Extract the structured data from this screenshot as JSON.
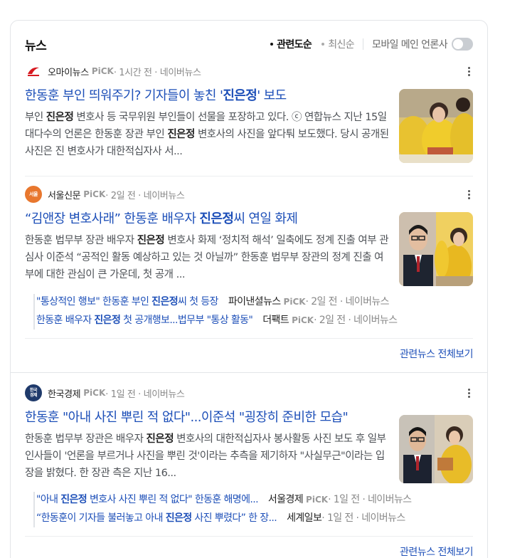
{
  "header": {
    "title": "뉴스",
    "filter_relevance": "관련도순",
    "filter_latest": "최신순",
    "mobile_main_label": "모바일 메인 언론사"
  },
  "articles": [
    {
      "publisher": "오마이뉴스",
      "pick": "PiCK",
      "meta": " · 1시간 전 · 네이버뉴스",
      "title_pre": "한동훈 부인 띄워주기? 기자들이 놓친 '",
      "title_bold": "진은정",
      "title_post": "' 보도",
      "snippet_parts": [
        "부인 ",
        "진은정",
        " 변호사 등 국무위원 부인들이 선물을 포장하고 있다. ⓒ 연합뉴스 지난 15일 대다수의 언론은 한동훈 장관 부인 ",
        "진은정",
        " 변호사의 사진을 앞다퉈 보도했다. 당시 공개된 사진은 진 변호사가 대한적십자사 서..."
      ],
      "logo_color": "#d71920"
    },
    {
      "publisher": "서울신문",
      "pick": "PiCK",
      "meta": " · 2일 전 · 네이버뉴스",
      "title_pre": "“김앤장 변호사래” 한동훈 배우자 ",
      "title_bold": "진은정",
      "title_post": "씨 연일 화제",
      "snippet_parts": [
        "한동훈 법무부 장관 배우자 ",
        "진은정",
        " 변호사 화제 ‘정치적 해석’ 일축에도 정계 진출 여부 관심사 이준석 “공적인 활동 예상하고 있는 것 아닐까” 한동훈 법무부 장관의 정계 진출 여부에 대한 관심이 큰 가운데, 첫 공개 ..."
      ],
      "logo_color": "#e8772e",
      "related": [
        {
          "pre": "\"통상적인 행보\" 한동훈 부인 ",
          "bold": "진은정",
          "post": "씨 첫 등장",
          "source": "파이낸셜뉴스",
          "pick": "PiCK",
          "meta": " · 2일 전 · 네이버뉴스"
        },
        {
          "pre": "한동훈 배우자 ",
          "bold": "진은정",
          "post": " 첫 공개행보...법무부 \"통상 활동\"",
          "source": "더팩트",
          "pick": "PiCK",
          "meta": " · 2일 전 · 네이버뉴스"
        }
      ],
      "more_label": "관련뉴스 전체보기"
    },
    {
      "publisher": "한국경제",
      "pick": "PiCK",
      "meta": " · 1일 전 · 네이버뉴스",
      "title_pre": "한동훈 \"아내 사진 뿌린 적 없다\"...이준석 \"굉장히 준비한 모습\"",
      "title_bold": "",
      "title_post": "",
      "snippet_parts": [
        "한동훈 법무부 장관은 배우자 ",
        "진은정",
        " 변호사의 대한적십자사 봉사활동 사진 보도 후 일부 인사들이 '언론을 부르거나 사진을 뿌린 것'이라는 추측을 제기하자 \"사실무근\"이라는 입장을 밝혔다. 한 장관 측은 지난 16..."
      ],
      "logo_color": "#1f3a6b",
      "logo_text": "한국경제",
      "related": [
        {
          "pre": "\"아내 ",
          "bold": "진은정",
          "post": " 변호사 사진 뿌린 적 없다\" 한동훈 해명에...",
          "source": "서울경제",
          "pick": "PiCK",
          "meta": " · 1일 전 · 네이버뉴스"
        },
        {
          "pre": "“한동훈이 기자들 불러놓고 아내 ",
          "bold": "진은정",
          "post": " 사진 뿌렸다” 한 장...",
          "source": "세계일보",
          "pick": "",
          "meta": " · 1일 전 · 네이버뉴스"
        }
      ],
      "more_label": "관련뉴스 전체보기"
    }
  ]
}
